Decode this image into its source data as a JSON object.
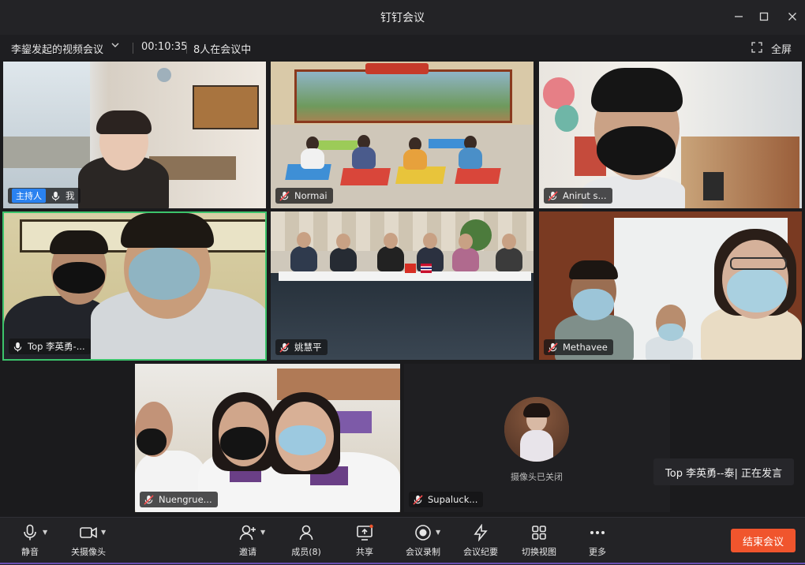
{
  "window": {
    "title": "钉钉会议",
    "controls": [
      "minimize-icon",
      "maximize-icon",
      "close-icon"
    ]
  },
  "meeting": {
    "name": "李鋆发起的视频会议",
    "timer": "00:10:35",
    "participants_count": "8人在会议中",
    "fullscreen_label": "全屏"
  },
  "tiles": [
    {
      "name": "我",
      "host_badge": "主持人",
      "mic": "on"
    },
    {
      "name": "Normai",
      "mic": "muted"
    },
    {
      "name": "Anirut s...",
      "mic": "muted"
    },
    {
      "name": "Top 李英勇-...",
      "mic": "on",
      "speaking": true
    },
    {
      "name": "姚慧平",
      "mic": "muted"
    },
    {
      "name": "Methavee",
      "mic": "muted"
    },
    {
      "name": "Nuengrue...",
      "mic": "muted"
    },
    {
      "name": "Supaluck...",
      "mic": "muted",
      "camera_off_text": "摄像头已关闭"
    }
  ],
  "speaking_toast": "Top 李英勇--泰| 正在发言",
  "toolbar": {
    "mute": "静音",
    "camera_off": "关摄像头",
    "invite": "邀请",
    "members": "成员(8)",
    "share": "共享",
    "record": "会议录制",
    "minutes": "会议纪要",
    "switch_view": "切换视图",
    "more": "更多",
    "end_meeting": "结束会议"
  },
  "colors": {
    "accent_blue": "#2a82f0",
    "end_button": "#f0552d",
    "speaking_border": "#3cc36b"
  }
}
